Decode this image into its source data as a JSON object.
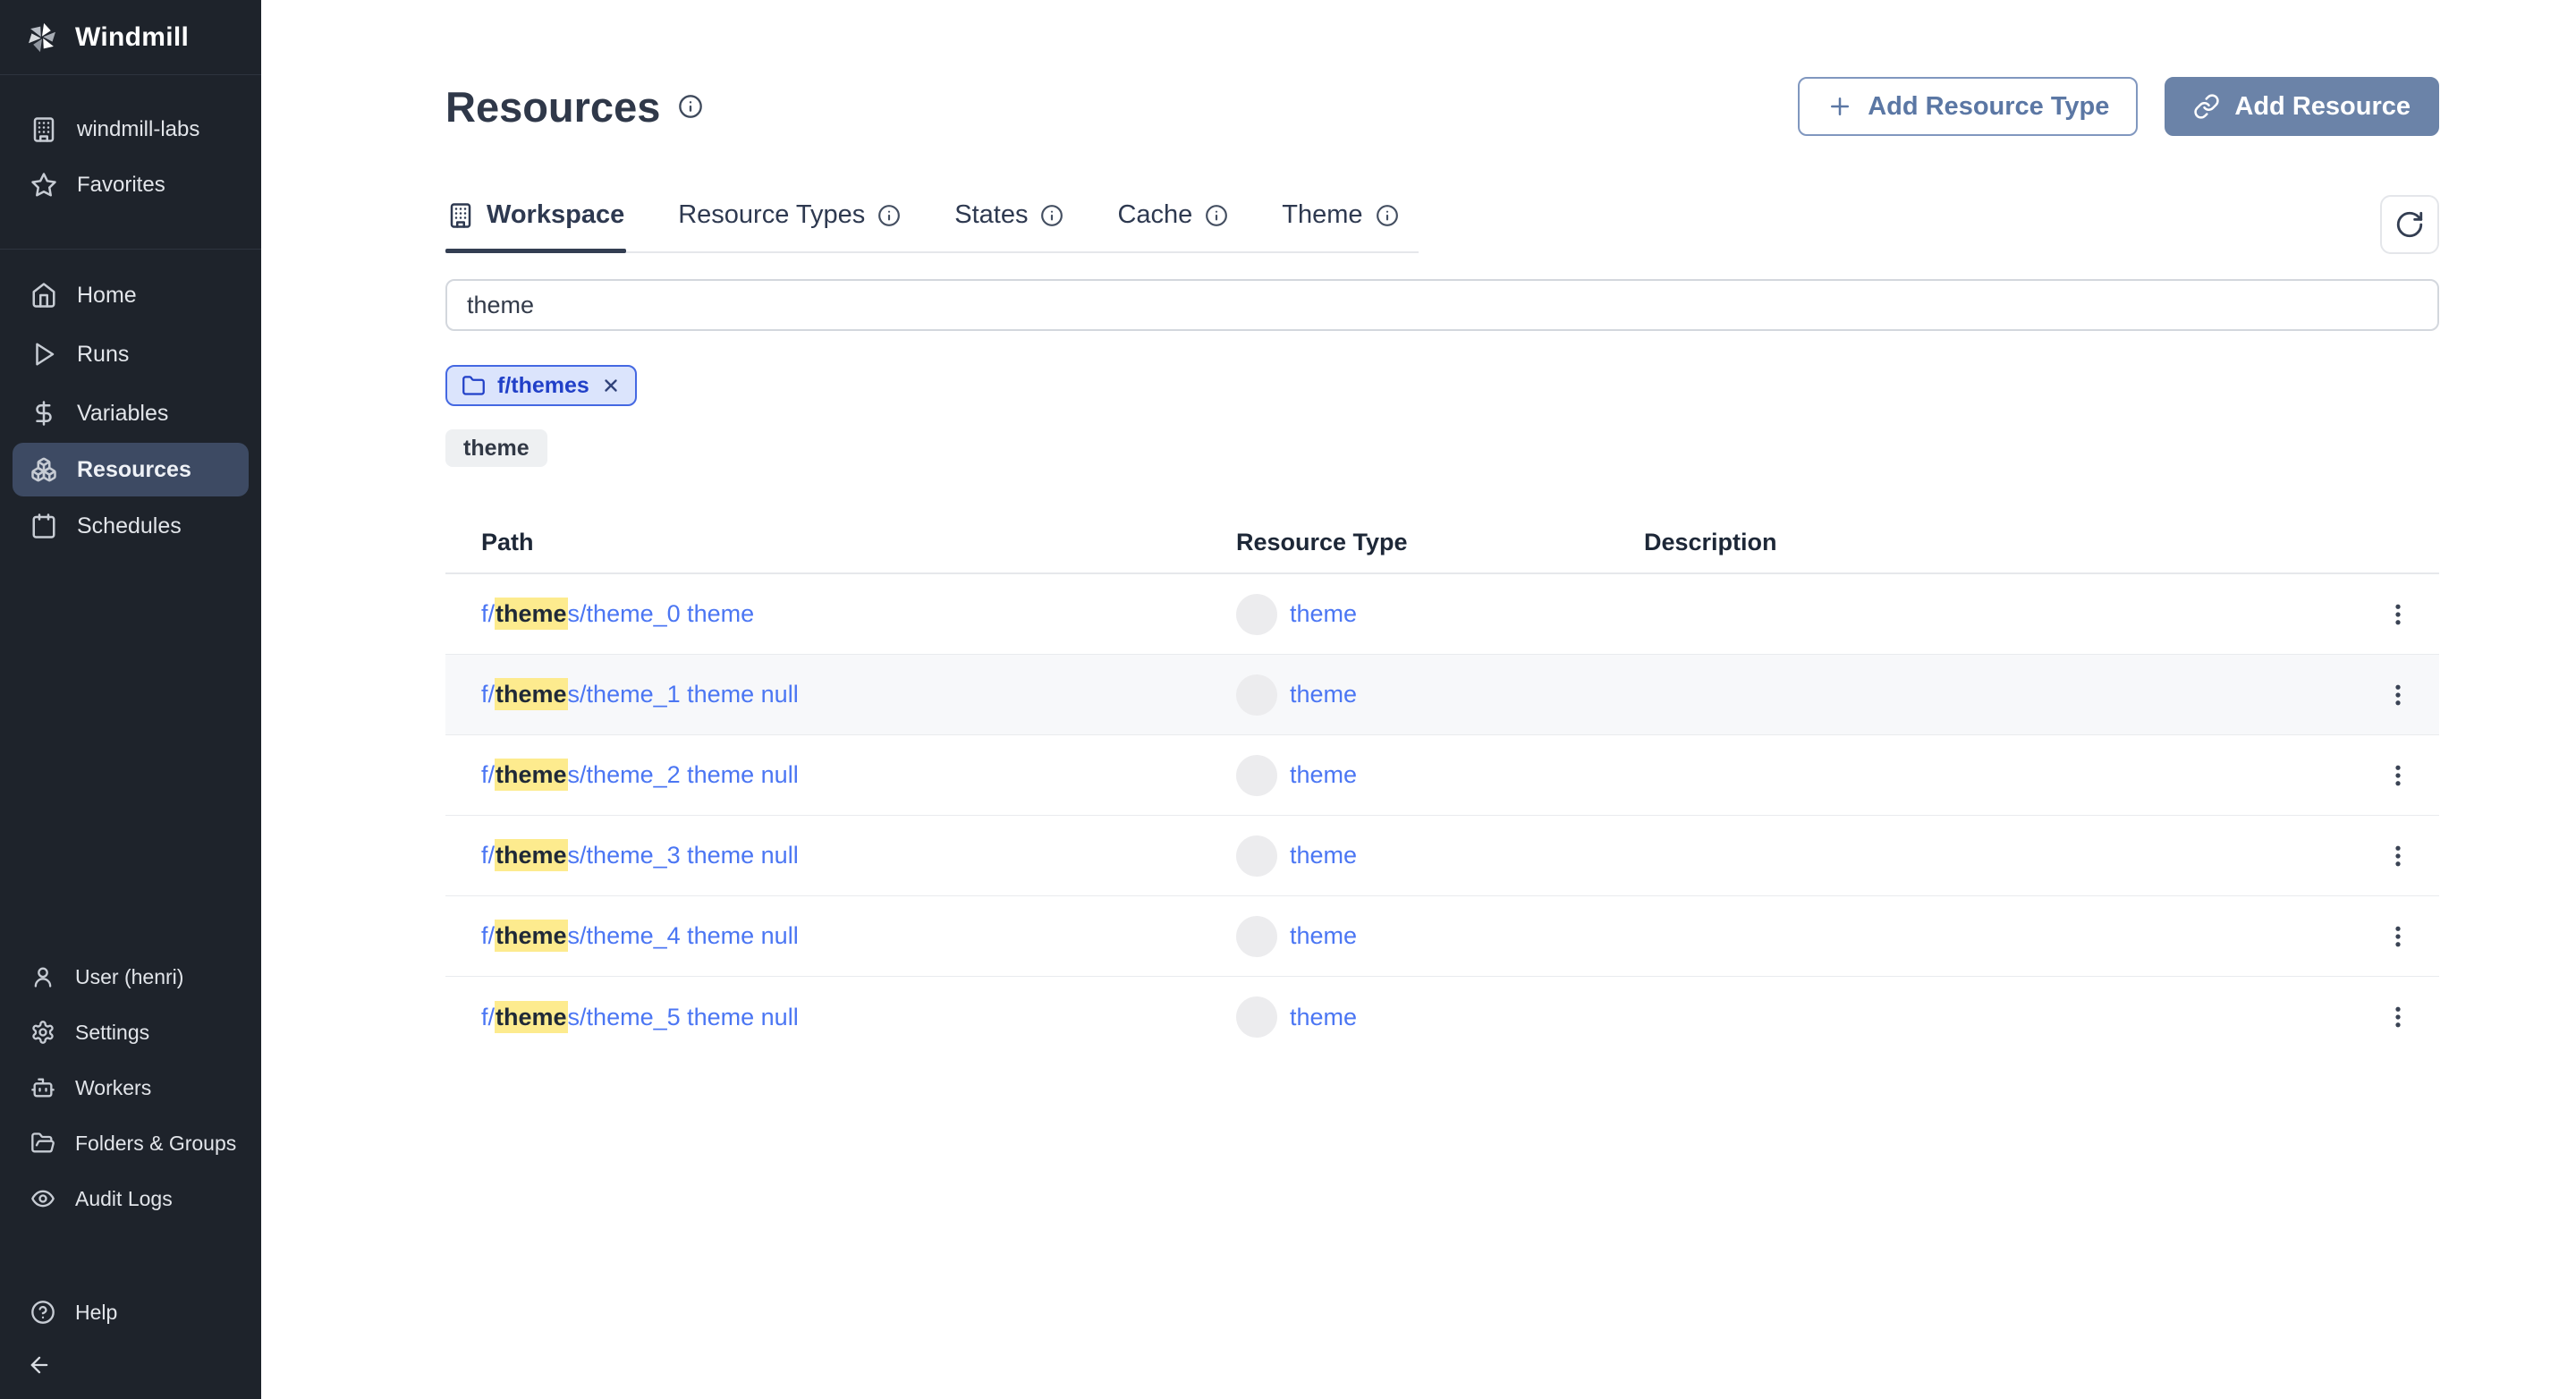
{
  "colors": {
    "sidebar_bg": "#1e232b",
    "sidebar_active_item_bg": "#3d4a63",
    "accent_slate_blue": "#6b83a8",
    "outline_button_text": "#5b77a4",
    "link_blue": "#4b76f3",
    "highlight_yellow": "#fdeb8e",
    "folder_chip_bg": "#dbe4fc",
    "folder_chip_border": "#4468e2",
    "folder_chip_text": "#2140c8",
    "gray_chip_bg": "#eef0f2",
    "row_alt_bg": "#f7f8fa",
    "tab_underline": "#333e52",
    "title_text": "#2f3849"
  },
  "sidebar": {
    "app_name": "Windmill",
    "logo_icon": "windmill-pinwheel-icon",
    "workspace_section": [
      {
        "icon": "building-icon",
        "label": "windmill-labs"
      },
      {
        "icon": "star-icon",
        "label": "Favorites"
      }
    ],
    "nav": [
      {
        "icon": "home-icon",
        "label": "Home",
        "active": false
      },
      {
        "icon": "play-icon",
        "label": "Runs",
        "active": false
      },
      {
        "icon": "dollar-icon",
        "label": "Variables",
        "active": false
      },
      {
        "icon": "boxes-icon",
        "label": "Resources",
        "active": true
      },
      {
        "icon": "calendar-icon",
        "label": "Schedules",
        "active": false
      }
    ],
    "footer": [
      {
        "icon": "user-icon",
        "label": "User (henri)"
      },
      {
        "icon": "gear-icon",
        "label": "Settings"
      },
      {
        "icon": "robot-icon",
        "label": "Workers"
      },
      {
        "icon": "folder-open-icon",
        "label": "Folders & Groups"
      },
      {
        "icon": "eye-icon",
        "label": "Audit Logs"
      }
    ],
    "help_label": "Help",
    "collapse_icon": "arrow-left-icon"
  },
  "header": {
    "title": "Resources",
    "title_info_icon": "info-icon",
    "buttons": {
      "add_resource_type": "Add Resource Type",
      "add_resource": "Add Resource"
    }
  },
  "tabs": [
    {
      "label": "Workspace",
      "active": true,
      "icon": "building-icon"
    },
    {
      "label": "Resource Types",
      "info": true
    },
    {
      "label": "States",
      "info": true
    },
    {
      "label": "Cache",
      "info": true
    },
    {
      "label": "Theme",
      "info": true
    }
  ],
  "toolbar": {
    "refresh_icon": "refresh-icon"
  },
  "search": {
    "value": "theme",
    "placeholder": ""
  },
  "filters": {
    "folder_chip_label": "f/themes",
    "folder_chip_icon": "folder-icon",
    "folder_chip_remove_icon": "x-icon",
    "text_chip_label": "theme"
  },
  "table": {
    "columns": [
      "Path",
      "Resource Type",
      "Description"
    ],
    "rows": [
      {
        "path_prefix": "f/",
        "path_match": "theme",
        "path_rest": "s/theme_0 theme",
        "resource_type": "theme",
        "description": ""
      },
      {
        "path_prefix": "f/",
        "path_match": "theme",
        "path_rest": "s/theme_1 theme null",
        "resource_type": "theme",
        "description": ""
      },
      {
        "path_prefix": "f/",
        "path_match": "theme",
        "path_rest": "s/theme_2 theme null",
        "resource_type": "theme",
        "description": ""
      },
      {
        "path_prefix": "f/",
        "path_match": "theme",
        "path_rest": "s/theme_3 theme null",
        "resource_type": "theme",
        "description": ""
      },
      {
        "path_prefix": "f/",
        "path_match": "theme",
        "path_rest": "s/theme_4 theme null",
        "resource_type": "theme",
        "description": ""
      },
      {
        "path_prefix": "f/",
        "path_match": "theme",
        "path_rest": "s/theme_5 theme null",
        "resource_type": "theme",
        "description": ""
      }
    ]
  }
}
